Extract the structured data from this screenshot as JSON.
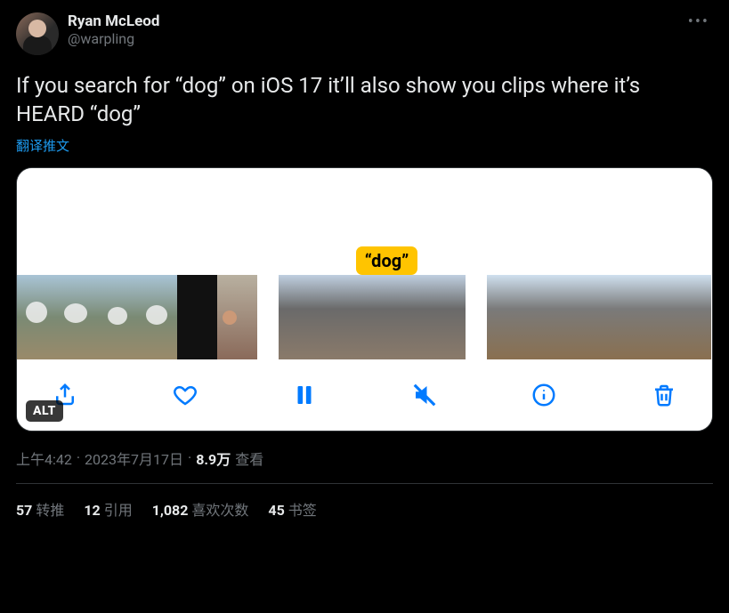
{
  "user": {
    "display_name": "Ryan McLeod",
    "handle": "@warpling"
  },
  "tweet_text": "If you search for “dog” on iOS 17 it’ll also show you clips where it’s HEARD “dog”",
  "translate_label": "翻译推文",
  "media": {
    "tooltip": "“dog”",
    "alt_badge": "ALT"
  },
  "meta": {
    "time": "上午4:42",
    "dot1": " · ",
    "date": "2023年7月17日",
    "dot2": " · ",
    "views_num": "8.9万",
    "views_label": " 查看"
  },
  "stats": {
    "retweets_n": "57",
    "retweets_l": "转推",
    "quotes_n": "12",
    "quotes_l": "引用",
    "likes_n": "1,082",
    "likes_l": "喜欢次数",
    "bookmarks_n": "45",
    "bookmarks_l": "书签"
  }
}
